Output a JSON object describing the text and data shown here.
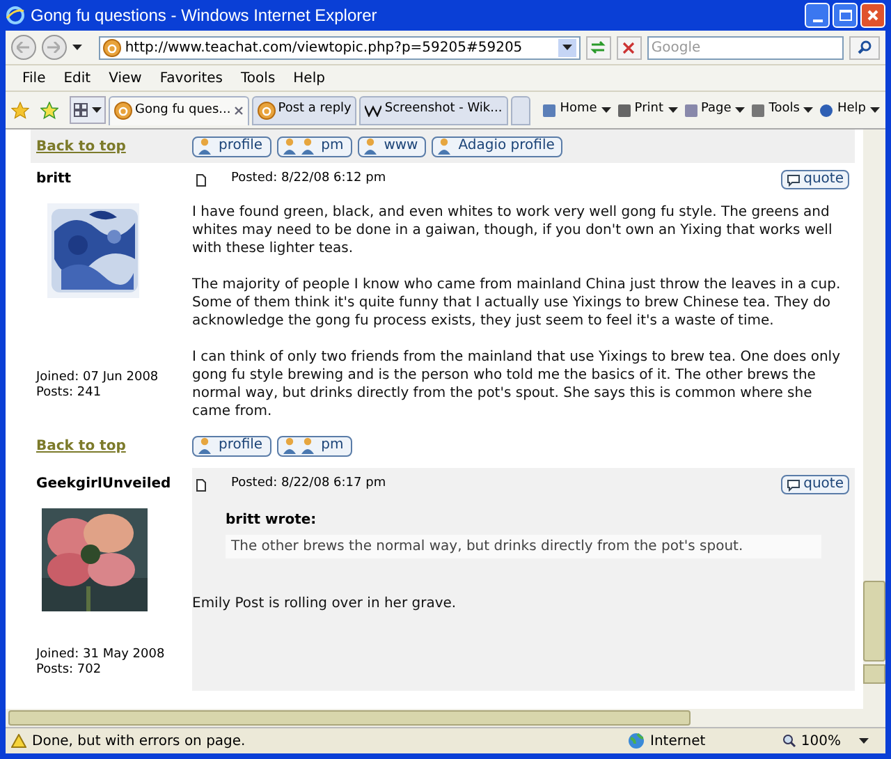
{
  "window": {
    "title": "Gong fu questions - Windows Internet Explorer"
  },
  "address_bar": {
    "url": "http://www.teachat.com/viewtopic.php?p=59205#59205",
    "search_placeholder": "Google"
  },
  "menu": [
    "File",
    "Edit",
    "View",
    "Favorites",
    "Tools",
    "Help"
  ],
  "tabs": [
    {
      "label": "Gong fu ques...",
      "selected": true,
      "kind": "site"
    },
    {
      "label": "Post a reply",
      "selected": false,
      "kind": "site"
    },
    {
      "label": "Screenshot - Wik...",
      "selected": false,
      "kind": "wiki"
    }
  ],
  "command_bar": [
    "Home",
    "Print",
    "Page",
    "Tools",
    "Help"
  ],
  "top_links": {
    "link": "Back to top",
    "buttons": [
      "profile",
      "pm",
      "www",
      "Adagio profile"
    ]
  },
  "posts": [
    {
      "author": "britt",
      "avatar": {
        "kind": "picture"
      },
      "joined": "Joined: 07 Jun 2008",
      "count": "Posts: 241",
      "posted": "Posted: 8/22/08 6:12 pm",
      "quote_button": "quote",
      "shaded": false,
      "paragraphs": [
        "I have found green, black, and even whites to work very well gong fu style. The greens and whites may need to be done in a gaiwan, though, if you don't own an Yixing that works well with these lighter teas.",
        "The majority of people I know who came from mainland China just throw the leaves in a cup. Some of them think it's quite funny that I actually use Yixings to brew Chinese tea. They do acknowledge the gong fu process exists, they just seem to feel it's a waste of time.",
        "I can think of only two friends from the mainland that use Yixings to brew tea. One does only gong fu style brewing and is the person who told me the basics of it. The other brews the normal way, but drinks directly from the pot's spout. She says this is common where she came from."
      ],
      "footer": {
        "link": "Back to top",
        "buttons": [
          "profile",
          "pm"
        ]
      }
    },
    {
      "author": "GeekgirlUnveiled",
      "avatar": {
        "kind": "picture"
      },
      "joined": "Joined: 31 May 2008",
      "count": "Posts: 702",
      "posted": "Posted: 8/22/08 6:17 pm",
      "quote_button": "quote",
      "shaded": true,
      "quote": {
        "author": "britt wrote:",
        "text": "The other brews the normal way, but drinks directly from the pot's spout."
      },
      "paragraphs": [
        "Emily Post is rolling over in her grave."
      ]
    }
  ],
  "status_bar": {
    "text": "Done, but with errors on page.",
    "zone": "Internet",
    "zoom": "100%"
  }
}
